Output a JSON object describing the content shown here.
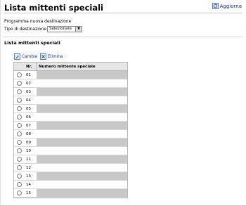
{
  "header": {
    "title": "Lista mittenti speciali",
    "update_label": "Aggiorna"
  },
  "form": {
    "program_label": "Programma nuova destinazione",
    "dest_type_label": "Tipo di destinazione",
    "dest_type_value": "Selezionare"
  },
  "list": {
    "section_title": "Lista mittenti speciali",
    "change_label": "Cambia",
    "delete_label": "Elimina",
    "columns": [
      "Nr.",
      "Numero mittente speciale"
    ],
    "rows": [
      "01",
      "02",
      "03",
      "04",
      "05",
      "06",
      "07",
      "08",
      "09",
      "10",
      "11",
      "12",
      "13",
      "14",
      "15"
    ]
  }
}
